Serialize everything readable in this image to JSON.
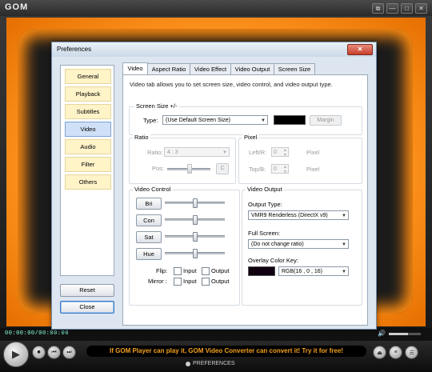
{
  "player": {
    "logo": "GOM",
    "window_buttons": [
      "⧉",
      "—",
      "□",
      "✕"
    ],
    "time": "00:00:00/00:00:00",
    "volume_level": 0.6,
    "marquee": "If GOM Player can play it, GOM Video Converter can convert it! Try it for free!",
    "preferences_label": "PREFERENCES"
  },
  "dialog": {
    "title": "Preferences",
    "close_label": "✕",
    "sidebar": [
      {
        "label": "General",
        "active": false
      },
      {
        "label": "Playback",
        "active": false
      },
      {
        "label": "Subtitles",
        "active": false
      },
      {
        "label": "Video",
        "active": true
      },
      {
        "label": "Audio",
        "active": false
      },
      {
        "label": "Filter",
        "active": false
      },
      {
        "label": "Others",
        "active": false
      }
    ],
    "reset_label": "Reset",
    "close_button_label": "Close",
    "tabs": [
      {
        "label": "Video",
        "active": true
      },
      {
        "label": "Aspect Ratio",
        "active": false
      },
      {
        "label": "Video Effect",
        "active": false
      },
      {
        "label": "Video Output",
        "active": false
      },
      {
        "label": "Screen Size",
        "active": false
      }
    ],
    "description": "Video tab allows you to set screen size, video control, and video output type.",
    "screen_size": {
      "legend": "Screen Size +/-",
      "type_label": "Type:",
      "type_value": "(Use Default Screen Size)",
      "margin_label": "Margin",
      "swatch_color": "#000000"
    },
    "ratio": {
      "legend": "Ratio",
      "ratio_label": "Ratio:",
      "ratio_value": "4 : 3",
      "pos_label": "Pos:",
      "c_label": "C"
    },
    "pixel": {
      "legend": "Pixel",
      "left_label": "Left/R:",
      "left_value": "0",
      "left_unit": "Pixel",
      "top_label": "Top/B:",
      "top_value": "0",
      "top_unit": "Pixel"
    },
    "video_control": {
      "legend": "Video Control",
      "buttons": [
        "Bri",
        "Con",
        "Sat",
        "Hue"
      ],
      "slider_levels": [
        0.5,
        0.5,
        0.5,
        0.5
      ],
      "flip_label": "Flip:",
      "mirror_label": "Mirror :",
      "input_label": "Input",
      "output_label": "Output"
    },
    "video_output": {
      "legend": "Video Output",
      "output_type_label": "Output Type:",
      "output_type_value": "VMR9 Renderless (DirectX v9)",
      "full_screen_label": "Full Screen:",
      "full_screen_value": "(Do not change ratio)",
      "overlay_label": "Overlay Color Key:",
      "overlay_value": "RGB(16 , 0 , 16)",
      "overlay_color": "#100010"
    }
  }
}
